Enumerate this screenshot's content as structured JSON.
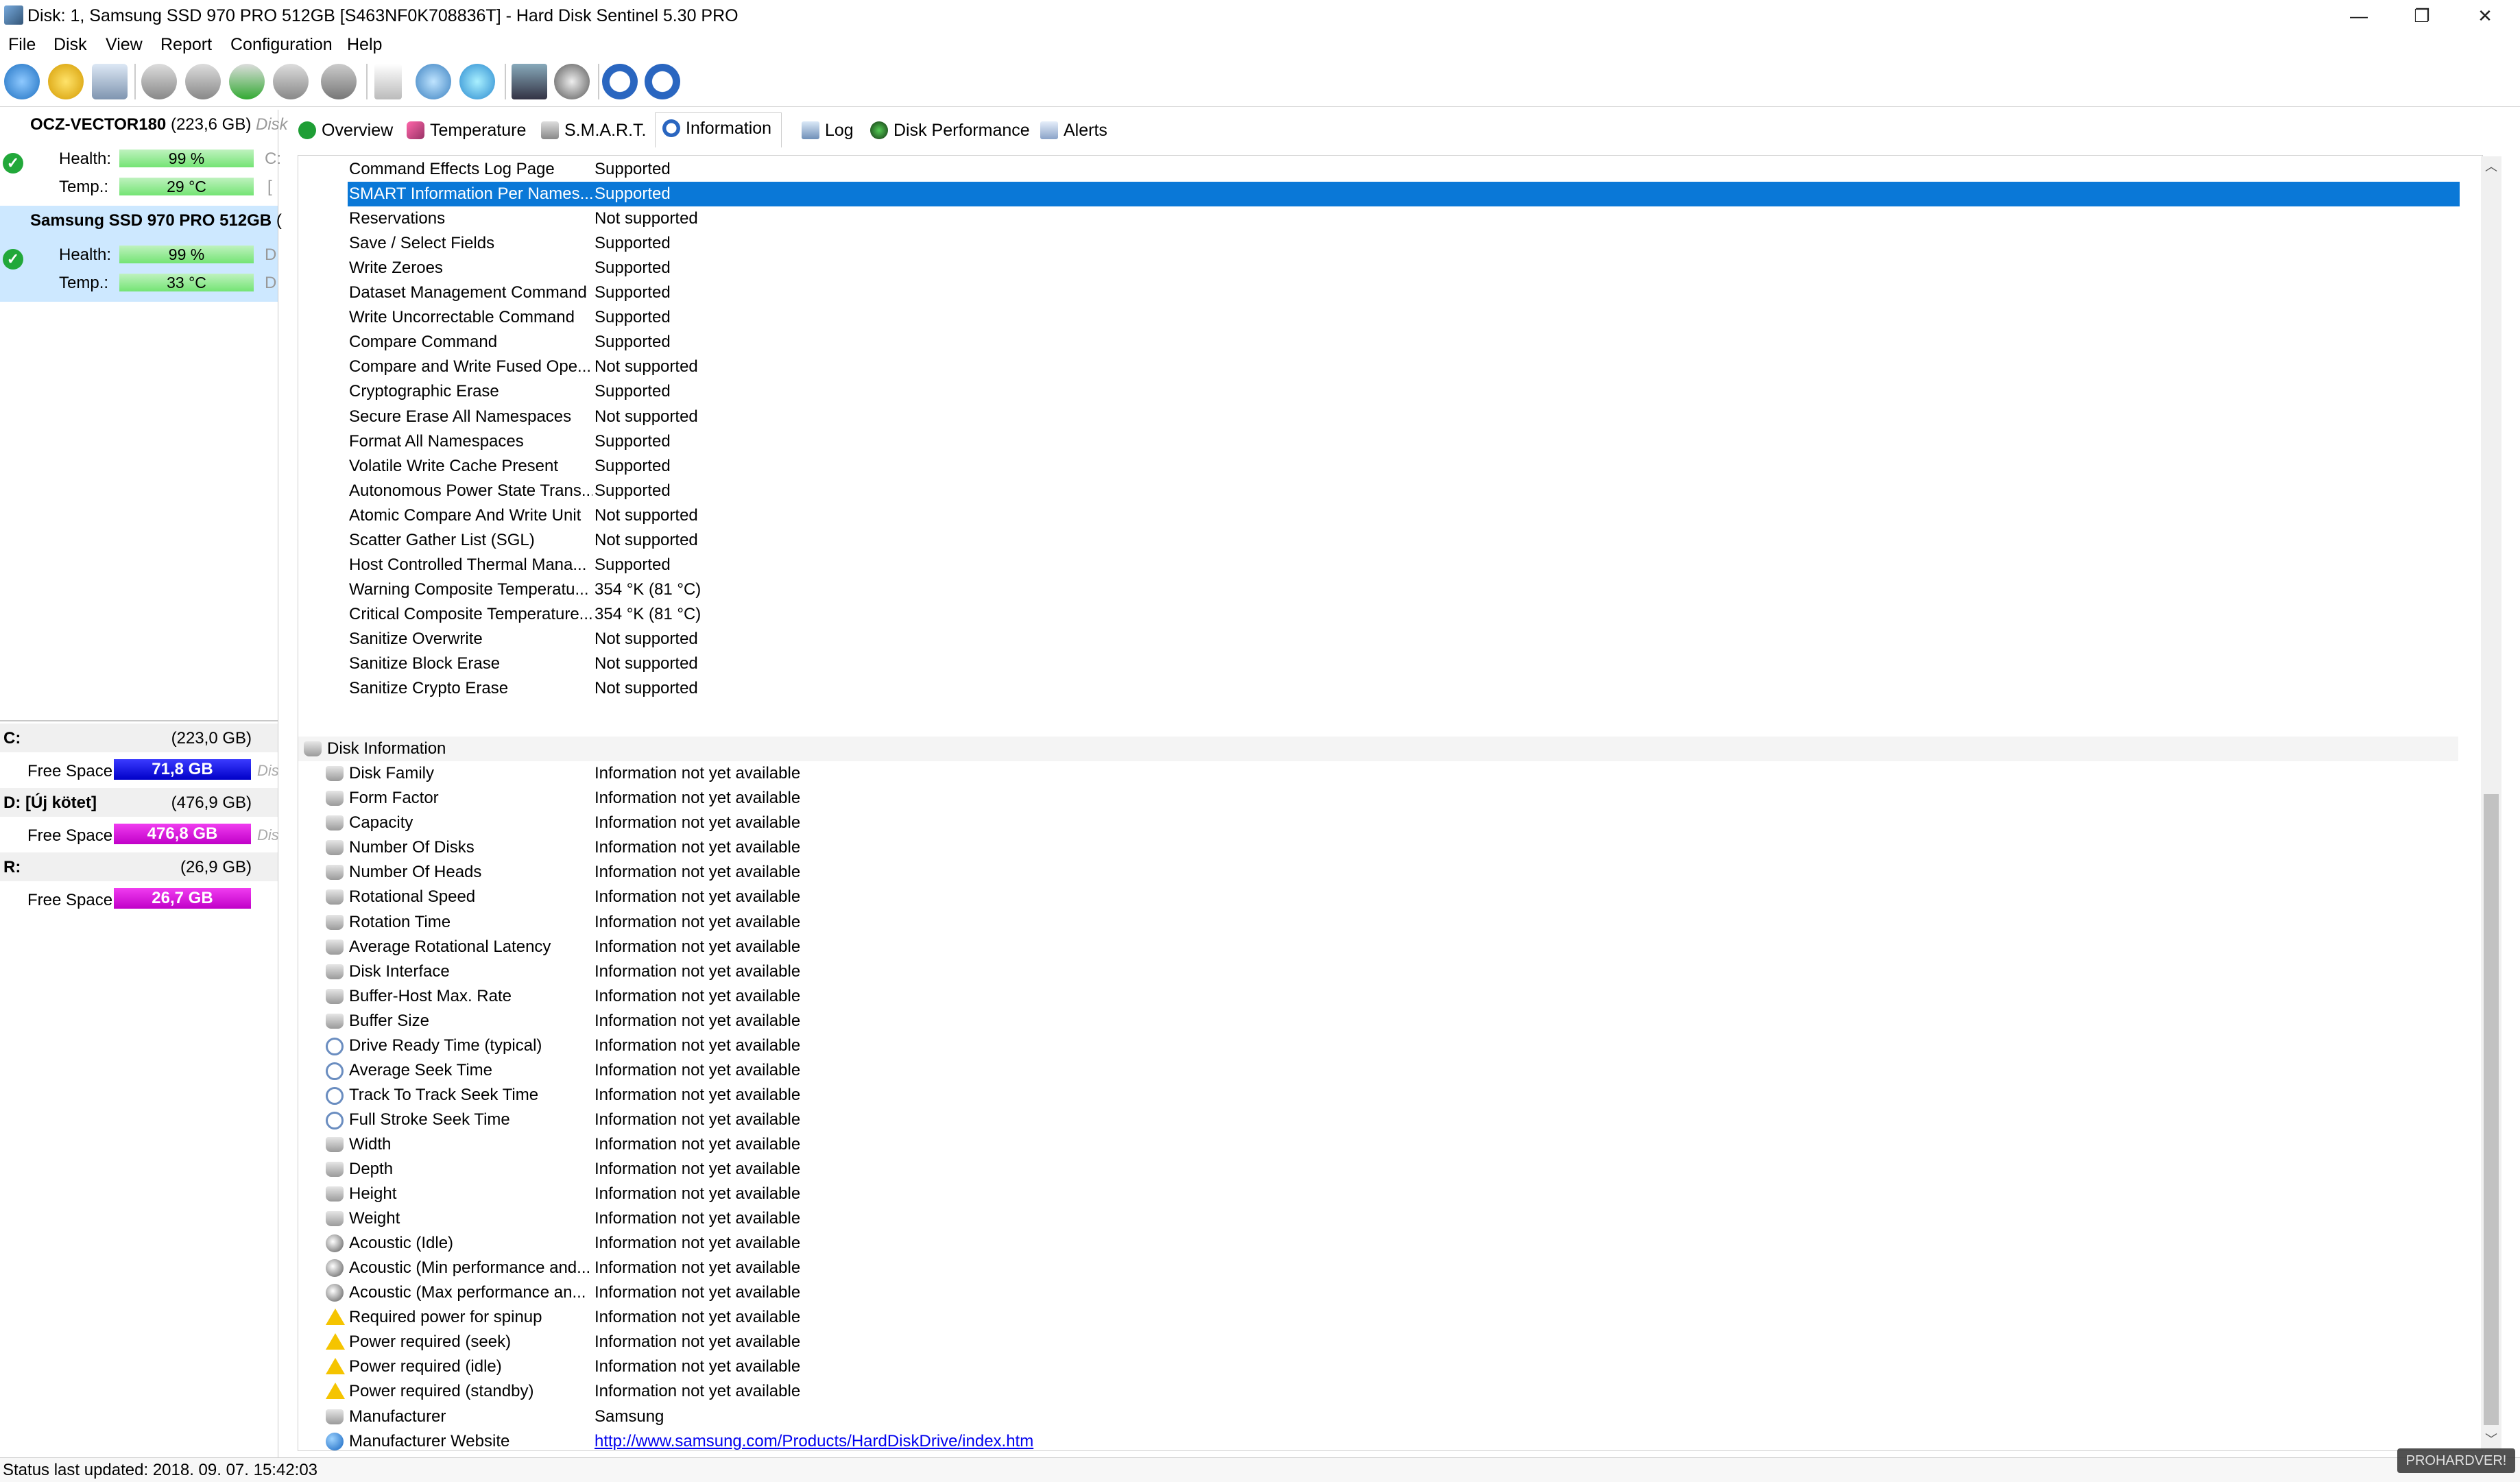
{
  "window": {
    "title": "Disk: 1, Samsung SSD 970 PRO 512GB [S463NF0K708836T]  -  Hard Disk Sentinel 5.30 PRO",
    "minimize": "—",
    "restore": "❐",
    "close": "✕"
  },
  "menu": [
    "File",
    "Disk",
    "View",
    "Report",
    "Configuration",
    "Help"
  ],
  "disks": [
    {
      "name": "OCZ-VECTOR180",
      "size": "(223,6 GB)",
      "ghost": "Disk",
      "health_label": "Health:",
      "health": "99 %",
      "health_ghost": "C:",
      "temp_label": "Temp.:",
      "temp": "29 °C",
      "temp_ghost": "[",
      "health_fraction": 0.99
    },
    {
      "name": "Samsung SSD 970 PRO 512GB",
      "size": "(",
      "ghost": "",
      "health_label": "Health:",
      "health": "99 %",
      "health_ghost": "D",
      "temp_label": "Temp.:",
      "temp": "33 °C",
      "temp_ghost": "D",
      "health_fraction": 0.99
    }
  ],
  "volumes": [
    {
      "letter": "C:",
      "size": "(223,0 GB)",
      "free_label": "Free Space",
      "free": "71,8 GB",
      "ghost": "Dis",
      "color": "#1a1ad6"
    },
    {
      "letter": "D: [Új kötet]",
      "size": "(476,9 GB)",
      "free_label": "Free Space",
      "free": "476,8 GB",
      "ghost": "Dis",
      "color": "#d21ad6"
    },
    {
      "letter": "R:",
      "size": "(26,9 GB)",
      "free_label": "Free Space",
      "free": "26,7 GB",
      "ghost": "",
      "color": "#d21ad6"
    }
  ],
  "tabs": [
    "Overview",
    "Temperature",
    "S.M.A.R.T.",
    "Information",
    "Log",
    "Disk Performance",
    "Alerts"
  ],
  "features": [
    {
      "label": "Command Effects Log Page",
      "value": "Supported"
    },
    {
      "label": "SMART Information Per Names...",
      "value": "Supported",
      "selected": true
    },
    {
      "label": "Reservations",
      "value": "Not supported"
    },
    {
      "label": "Save / Select Fields",
      "value": "Supported"
    },
    {
      "label": "Write Zeroes",
      "value": "Supported"
    },
    {
      "label": "Dataset Management Command",
      "value": "Supported"
    },
    {
      "label": "Write Uncorrectable Command",
      "value": "Supported"
    },
    {
      "label": "Compare Command",
      "value": "Supported"
    },
    {
      "label": "Compare and Write Fused Ope...",
      "value": "Not supported"
    },
    {
      "label": "Cryptographic Erase",
      "value": "Supported"
    },
    {
      "label": "Secure Erase All Namespaces",
      "value": "Not supported"
    },
    {
      "label": "Format All Namespaces",
      "value": "Supported"
    },
    {
      "label": "Volatile Write Cache Present",
      "value": "Supported"
    },
    {
      "label": "Autonomous Power State Trans...",
      "value": "Supported"
    },
    {
      "label": "Atomic Compare And Write Unit",
      "value": "Not supported"
    },
    {
      "label": "Scatter Gather List (SGL)",
      "value": "Not supported"
    },
    {
      "label": "Host Controlled Thermal Mana...",
      "value": "Supported"
    },
    {
      "label": "Warning Composite Temperatu...",
      "value": "354 °K (81 °C)"
    },
    {
      "label": "Critical Composite Temperature...",
      "value": "354 °K (81 °C)"
    },
    {
      "label": "Sanitize Overwrite",
      "value": "Not supported"
    },
    {
      "label": "Sanitize Block Erase",
      "value": "Not supported"
    },
    {
      "label": "Sanitize Crypto Erase",
      "value": "Not supported"
    }
  ],
  "disk_info_header": "Disk Information",
  "disk_info": [
    {
      "label": "Disk Family",
      "value": "Information not yet available",
      "icon": "disk-icon"
    },
    {
      "label": "Form Factor",
      "value": "Information not yet available",
      "icon": "disk-icon"
    },
    {
      "label": "Capacity",
      "value": "Information not yet available",
      "icon": "disk-icon"
    },
    {
      "label": "Number Of Disks",
      "value": "Information not yet available",
      "icon": "disk-icon"
    },
    {
      "label": "Number Of Heads",
      "value": "Information not yet available",
      "icon": "disk-icon"
    },
    {
      "label": "Rotational Speed",
      "value": "Information not yet available",
      "icon": "disk-icon"
    },
    {
      "label": "Rotation Time",
      "value": "Information not yet available",
      "icon": "disk-icon"
    },
    {
      "label": "Average Rotational Latency",
      "value": "Information not yet available",
      "icon": "disk-icon"
    },
    {
      "label": "Disk Interface",
      "value": "Information not yet available",
      "icon": "disk-icon"
    },
    {
      "label": "Buffer-Host Max. Rate",
      "value": "Information not yet available",
      "icon": "disk-icon"
    },
    {
      "label": "Buffer Size",
      "value": "Information not yet available",
      "icon": "disk-icon"
    },
    {
      "label": "Drive Ready Time (typical)",
      "value": "Information not yet available",
      "icon": "clock-icon"
    },
    {
      "label": "Average Seek Time",
      "value": "Information not yet available",
      "icon": "clock-icon"
    },
    {
      "label": "Track To Track Seek Time",
      "value": "Information not yet available",
      "icon": "clock-icon"
    },
    {
      "label": "Full Stroke Seek Time",
      "value": "Information not yet available",
      "icon": "clock-icon"
    },
    {
      "label": "Width",
      "value": "Information not yet available",
      "icon": "disk-icon"
    },
    {
      "label": "Depth",
      "value": "Information not yet available",
      "icon": "disk-icon"
    },
    {
      "label": "Height",
      "value": "Information not yet available",
      "icon": "disk-icon"
    },
    {
      "label": "Weight",
      "value": "Information not yet available",
      "icon": "disk-icon"
    },
    {
      "label": "Acoustic (Idle)",
      "value": "Information not yet available",
      "icon": "speaker-icon"
    },
    {
      "label": "Acoustic (Min performance and...",
      "value": "Information not yet available",
      "icon": "speaker-icon"
    },
    {
      "label": "Acoustic (Max performance an...",
      "value": "Information not yet available",
      "icon": "speaker-icon"
    },
    {
      "label": "Required power for spinup",
      "value": "Information not yet available",
      "icon": "warning-icon"
    },
    {
      "label": "Power required (seek)",
      "value": "Information not yet available",
      "icon": "warning-icon"
    },
    {
      "label": "Power required (idle)",
      "value": "Information not yet available",
      "icon": "warning-icon"
    },
    {
      "label": "Power required (standby)",
      "value": "Information not yet available",
      "icon": "warning-icon"
    },
    {
      "label": "Manufacturer",
      "value": "Samsung",
      "icon": "disk-icon"
    },
    {
      "label": "Manufacturer Website",
      "value": "http://www.samsung.com/Products/HardDiskDrive/index.htm",
      "icon": "globe-icon",
      "link": true
    }
  ],
  "status": "Status last updated: 2018. 09. 07. 15:42:03",
  "watermark": "PROHARDVER!"
}
